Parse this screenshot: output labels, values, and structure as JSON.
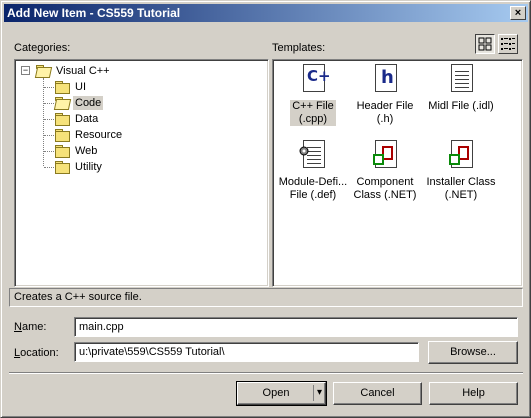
{
  "window": {
    "title": "Add New Item - CS559 Tutorial",
    "close_glyph": "×"
  },
  "categories": {
    "label": "Categories:",
    "root": "Visual C++",
    "expander": "−",
    "items": [
      "UI",
      "Code",
      "Data",
      "Resource",
      "Web",
      "Utility"
    ],
    "selected": "Code"
  },
  "templates": {
    "label": "Templates:",
    "items": [
      {
        "line1": "C++ File",
        "line2": "(.cpp)",
        "icon": "cpp-file-icon"
      },
      {
        "line1": "Header File",
        "line2": "(.h)",
        "icon": "header-file-icon"
      },
      {
        "line1": "Midl File (.idl)",
        "line2": "",
        "icon": "midl-file-icon"
      },
      {
        "line1": "Module-Defi...",
        "line2": "File (.def)",
        "icon": "module-definition-icon"
      },
      {
        "line1": "Component",
        "line2": "Class (.NET)",
        "icon": "component-class-icon"
      },
      {
        "line1": "Installer Class",
        "line2": "(.NET)",
        "icon": "installer-class-icon"
      }
    ],
    "cpp_glyph": "C+",
    "header_glyph": "h"
  },
  "description": "Creates a C++ source file.",
  "name": {
    "label": "Name:",
    "value": "main.cpp"
  },
  "location": {
    "label": "Location:",
    "value": "u:\\private\\559\\CS559 Tutorial\\"
  },
  "buttons": {
    "browse": "Browse...",
    "open": "Open",
    "open_arrow": "▾",
    "cancel": "Cancel",
    "help": "Help"
  }
}
